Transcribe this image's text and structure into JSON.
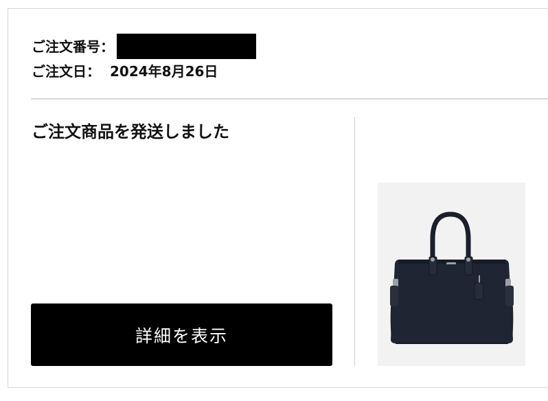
{
  "order": {
    "number_label": "ご注文番号：",
    "date_label": "ご注文日：",
    "date_value": "2024年8月26日"
  },
  "status": {
    "message": "ご注文商品を発送しました"
  },
  "actions": {
    "view_details_label": "詳細を表示"
  },
  "product": {
    "image_icon": "tote-bag-image",
    "colors": {
      "bag": "#1f2533",
      "hardware": "#9aa0a6",
      "background": "#f2f2f2"
    }
  }
}
